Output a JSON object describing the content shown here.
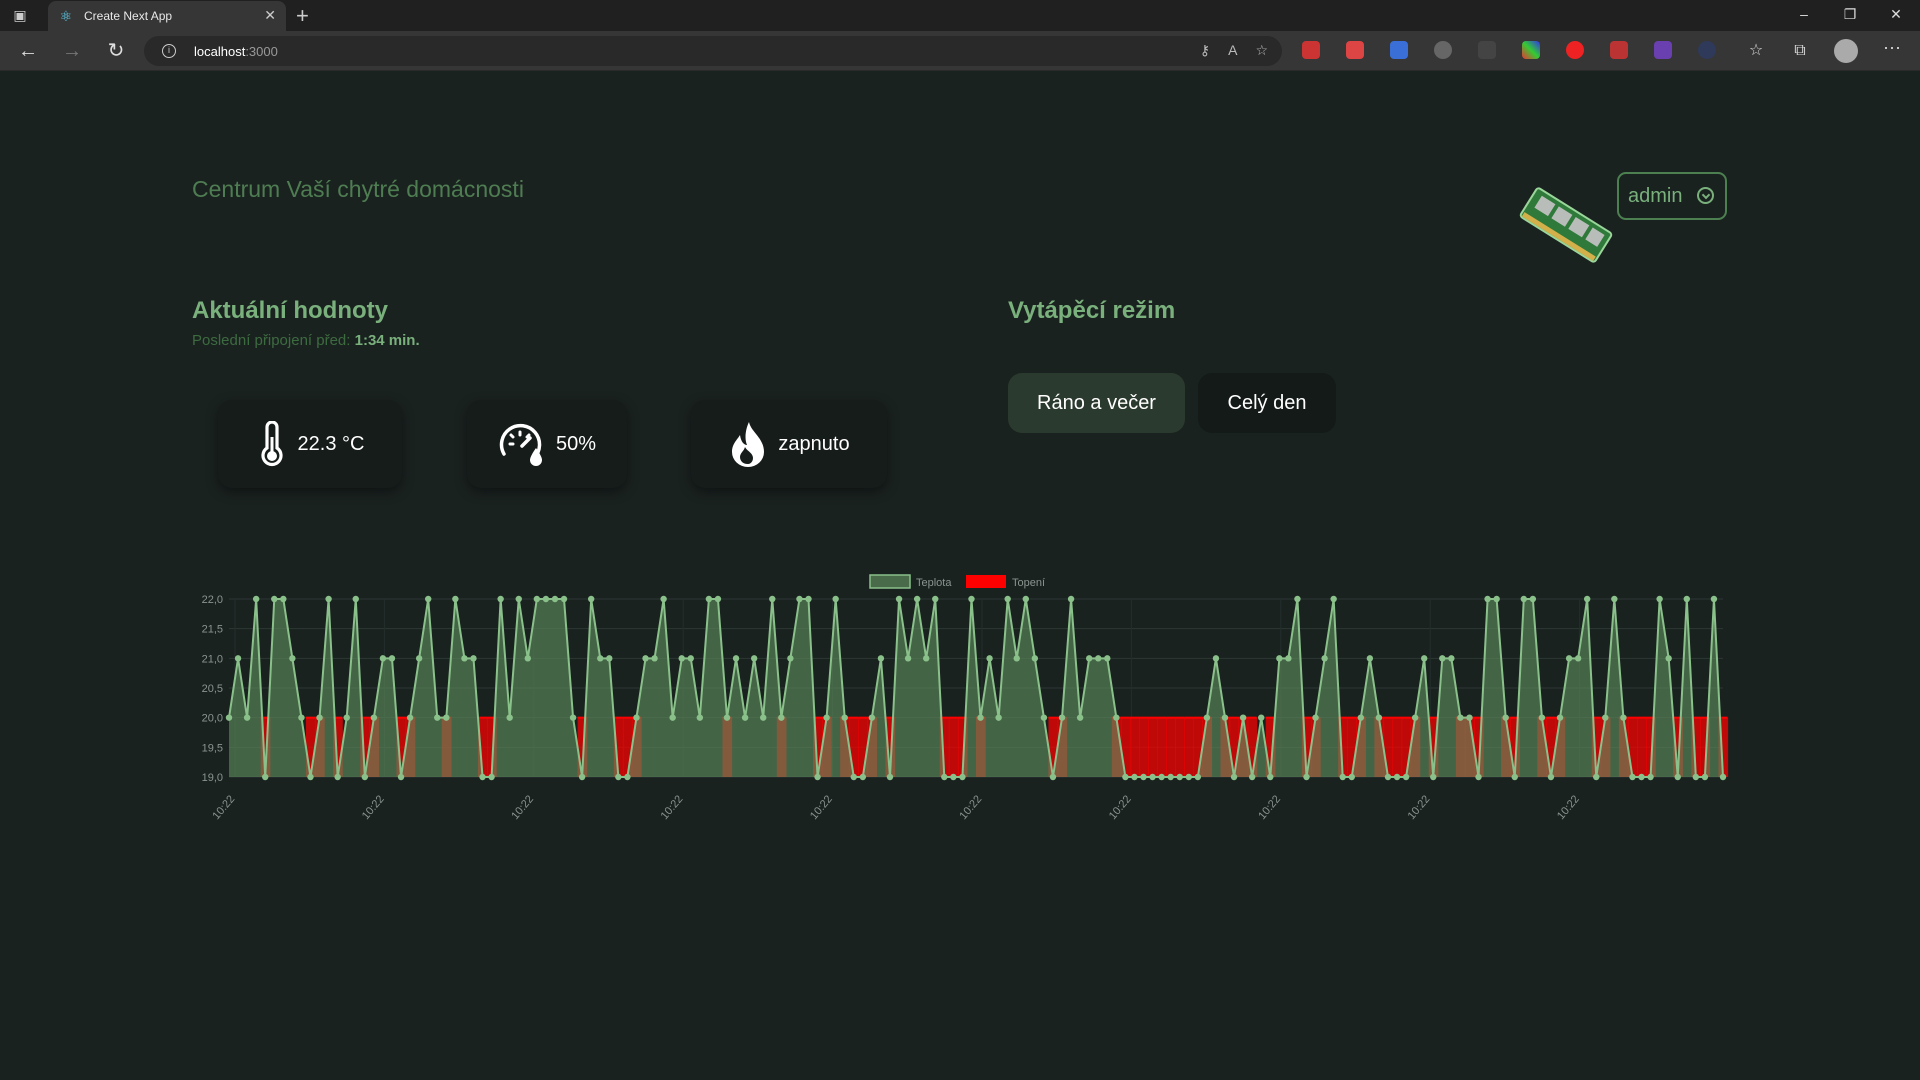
{
  "browser": {
    "tab_title": "Create Next App",
    "address_host": "localhost",
    "address_port": ":3000"
  },
  "app": {
    "title": "Centrum Vaší chytré domácnosti",
    "user_label": "admin"
  },
  "current": {
    "heading": "Aktuální hodnoty",
    "last_connection_label": "Poslední připojení před:",
    "last_connection_value": "1:34 min.",
    "temperature": "22.3 °C",
    "humidity": "50%",
    "heating": "zapnuto",
    "icons": [
      "thermometer-icon",
      "humidity-gauge-icon",
      "flame-icon"
    ]
  },
  "heating_mode": {
    "heading": "Vytápěcí režim",
    "options": [
      "Ráno a večer",
      "Celý den"
    ],
    "selected": "Ráno a večer"
  },
  "colors": {
    "accent": "#79b07c",
    "temperature_fill": "#4a6b49",
    "temperature_line": "#8ac08a",
    "heating": "#ff0000",
    "background": "#1a2220"
  },
  "chart_data": {
    "type": "line",
    "legend": [
      "Teplota",
      "Topení"
    ],
    "legend_position": "top",
    "ylim": [
      19,
      22
    ],
    "y_ticks": [
      "19,0",
      "19,5",
      "20,0",
      "20,5",
      "21,0",
      "21,5",
      "22,0"
    ],
    "x_tick_labels": [
      "10:22",
      "10:22",
      "10:22",
      "10:22",
      "10:22",
      "10:22",
      "10:22",
      "10:22",
      "10:22",
      "10:22"
    ],
    "grid": true,
    "series": [
      {
        "name": "Teplota",
        "values": [
          20,
          21,
          20,
          22,
          19,
          22,
          22,
          21,
          20,
          19,
          20,
          22,
          19,
          20,
          22,
          19,
          20,
          21,
          21,
          19,
          20,
          21,
          22,
          20,
          20,
          22,
          21,
          21,
          19,
          19,
          22,
          20,
          22,
          21,
          22,
          22,
          22,
          22,
          20,
          19,
          22,
          21,
          21,
          19,
          19,
          20,
          21,
          21,
          22,
          20,
          21,
          21,
          20,
          22,
          22,
          20,
          21,
          20,
          21,
          20,
          22,
          20,
          21,
          22,
          22,
          19,
          20,
          22,
          20,
          19,
          19,
          20,
          21,
          19,
          22,
          21,
          22,
          21,
          22,
          19,
          19,
          19,
          22,
          20,
          21,
          20,
          22,
          21,
          22,
          21,
          20,
          19,
          20,
          22,
          20,
          21,
          21,
          21,
          20,
          19,
          19,
          19,
          19,
          19,
          19,
          19,
          19,
          19,
          20,
          21,
          20,
          19,
          20,
          19,
          20,
          19,
          21,
          21,
          22,
          19,
          20,
          21,
          22,
          19,
          19,
          20,
          21,
          20,
          19,
          19,
          19,
          20,
          21,
          19,
          21,
          21,
          20,
          20,
          19,
          22,
          22,
          20,
          19,
          22,
          22,
          20,
          19,
          20,
          21,
          21,
          22,
          19,
          20,
          22,
          20,
          19,
          19,
          19,
          22,
          21,
          19,
          22,
          19,
          19,
          22,
          19
        ],
        "color": "#8ac08a"
      },
      {
        "name": "Topení",
        "values": [
          0,
          0,
          0,
          0,
          1,
          0,
          0,
          0,
          0,
          1,
          1,
          0,
          1,
          0,
          0,
          1,
          1,
          0,
          0,
          1,
          1,
          0,
          0,
          0,
          1,
          0,
          0,
          0,
          1,
          1,
          0,
          0,
          0,
          0,
          0,
          0,
          0,
          0,
          0,
          1,
          0,
          0,
          0,
          1,
          1,
          1,
          0,
          0,
          0,
          0,
          0,
          0,
          0,
          0,
          0,
          1,
          0,
          0,
          0,
          0,
          0,
          1,
          0,
          0,
          0,
          1,
          1,
          0,
          1,
          1,
          1,
          1,
          0,
          1,
          0,
          0,
          0,
          0,
          0,
          1,
          1,
          1,
          0,
          1,
          0,
          0,
          0,
          0,
          0,
          0,
          0,
          1,
          1,
          0,
          0,
          0,
          0,
          0,
          1,
          1,
          1,
          1,
          1,
          1,
          1,
          1,
          1,
          1,
          1,
          0,
          1,
          1,
          1,
          1,
          0,
          1,
          0,
          0,
          0,
          1,
          1,
          0,
          0,
          1,
          1,
          1,
          0,
          1,
          1,
          1,
          1,
          1,
          0,
          1,
          0,
          0,
          1,
          1,
          1,
          0,
          0,
          1,
          1,
          0,
          0,
          1,
          1,
          1,
          0,
          0,
          0,
          1,
          1,
          0,
          1,
          1,
          1,
          1,
          0,
          0,
          1,
          0,
          1,
          1,
          0,
          1
        ],
        "color": "#ff0000"
      }
    ]
  }
}
